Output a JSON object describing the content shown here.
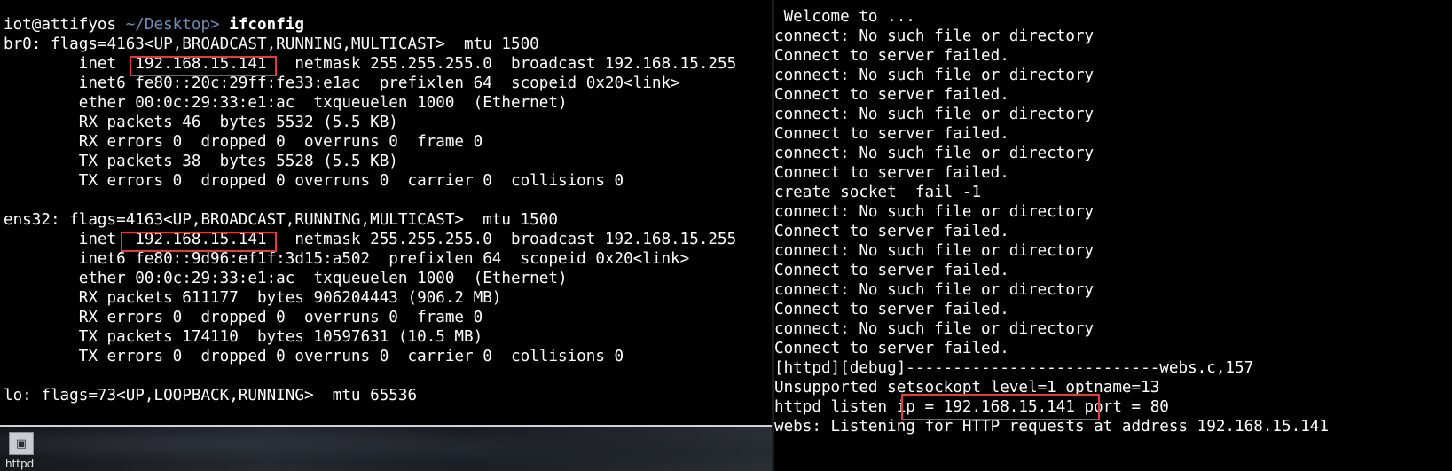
{
  "left_terminal": {
    "prompt": {
      "user_host": "iot@attifyos",
      "path": "~/Desktop",
      "symbol": ">",
      "command": "ifconfig"
    },
    "lines": [
      "br0: flags=4163<UP,BROADCAST,RUNNING,MULTICAST>  mtu 1500",
      "        inet  192.168.15.141   netmask 255.255.255.0  broadcast 192.168.15.255",
      "        inet6 fe80::20c:29ff:fe33:e1ac  prefixlen 64  scopeid 0x20<link>",
      "        ether 00:0c:29:33:e1:ac  txqueuelen 1000  (Ethernet)",
      "        RX packets 46  bytes 5532 (5.5 KB)",
      "        RX errors 0  dropped 0  overruns 0  frame 0",
      "        TX packets 38  bytes 5528 (5.5 KB)",
      "        TX errors 0  dropped 0 overruns 0  carrier 0  collisions 0",
      "",
      "ens32: flags=4163<UP,BROADCAST,RUNNING,MULTICAST>  mtu 1500",
      "        inet  192.168.15.141   netmask 255.255.255.0  broadcast 192.168.15.255",
      "        inet6 fe80::9d96:ef1f:3d15:a502  prefixlen 64  scopeid 0x20<link>",
      "        ether 00:0c:29:33:e1:ac  txqueuelen 1000  (Ethernet)",
      "        RX packets 611177  bytes 906204443 (906.2 MB)",
      "        RX errors 0  dropped 0  overruns 0  frame 0",
      "        TX packets 174110  bytes 10597631 (10.5 MB)",
      "        TX errors 0  dropped 0 overruns 0  carrier 0  collisions 0",
      "",
      "lo: flags=73<UP,LOOPBACK,RUNNING>  mtu 65536"
    ]
  },
  "right_terminal": {
    "lines": [
      " Welcome to ...",
      "connect: No such file or directory",
      "Connect to server failed.",
      "connect: No such file or directory",
      "Connect to server failed.",
      "connect: No such file or directory",
      "Connect to server failed.",
      "connect: No such file or directory",
      "Connect to server failed.",
      "create socket  fail -1",
      "connect: No such file or directory",
      "Connect to server failed.",
      "connect: No such file or directory",
      "Connect to server failed.",
      "connect: No such file or directory",
      "Connect to server failed.",
      "connect: No such file or directory",
      "Connect to server failed.",
      "[httpd][debug]---------------------------webs.c,157",
      "Unsupported setsockopt level=1 optname=13",
      "httpd listen ip = 192.168.15.141 port = 80",
      "webs: Listening for HTTP requests at address 192.168.15.141"
    ]
  },
  "desktop": {
    "dock_icon": "terminal-icon",
    "dock_label": "httpd"
  },
  "colors": {
    "background": "#000000",
    "text": "#ffffff",
    "prompt_path": "#6f8fb5",
    "highlight_box": "#e53a3a"
  }
}
